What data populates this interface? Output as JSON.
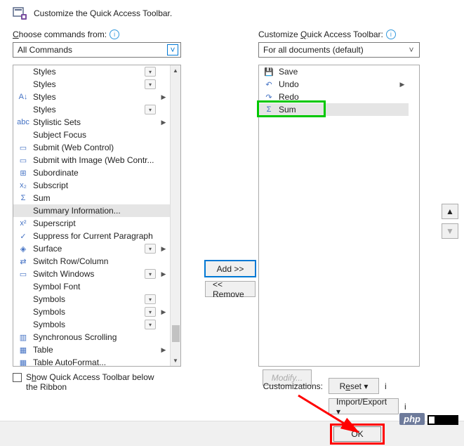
{
  "header": {
    "title": "Customize the Quick Access Toolbar."
  },
  "left": {
    "label": "Choose commands from:",
    "dropdown": "All Commands",
    "items": [
      {
        "label": "Styles",
        "icon": "",
        "drop": true,
        "sub": false
      },
      {
        "label": "Styles",
        "icon": "",
        "drop": true,
        "sub": false
      },
      {
        "label": "Styles",
        "icon": "A↓",
        "drop": false,
        "sub": true
      },
      {
        "label": "Styles",
        "icon": "",
        "drop": true,
        "sub": false
      },
      {
        "label": "Stylistic Sets",
        "icon": "abc",
        "drop": false,
        "sub": true
      },
      {
        "label": "Subject Focus",
        "icon": "",
        "drop": false,
        "sub": false
      },
      {
        "label": "Submit (Web Control)",
        "icon": "▭",
        "drop": false,
        "sub": false
      },
      {
        "label": "Submit with Image (Web Contr...",
        "icon": "▭",
        "drop": false,
        "sub": false
      },
      {
        "label": "Subordinate",
        "icon": "⊞",
        "drop": false,
        "sub": false
      },
      {
        "label": "Subscript",
        "icon": "x₂",
        "drop": false,
        "sub": false
      },
      {
        "label": "Sum",
        "icon": "Σ",
        "drop": false,
        "sub": false
      },
      {
        "label": "Summary Information...",
        "icon": "",
        "drop": false,
        "sub": false,
        "selected": true
      },
      {
        "label": "Superscript",
        "icon": "x²",
        "drop": false,
        "sub": false
      },
      {
        "label": "Suppress for Current Paragraph",
        "icon": "✓",
        "drop": false,
        "sub": false
      },
      {
        "label": "Surface",
        "icon": "◈",
        "drop": true,
        "sub": true
      },
      {
        "label": "Switch Row/Column",
        "icon": "⇄",
        "drop": false,
        "sub": false
      },
      {
        "label": "Switch Windows",
        "icon": "▭",
        "drop": true,
        "sub": true
      },
      {
        "label": "Symbol Font",
        "icon": "",
        "drop": false,
        "sub": false
      },
      {
        "label": "Symbols",
        "icon": "",
        "drop": true,
        "sub": false
      },
      {
        "label": "Symbols",
        "icon": "",
        "drop": true,
        "sub": true
      },
      {
        "label": "Symbols",
        "icon": "",
        "drop": true,
        "sub": false
      },
      {
        "label": "Synchronous Scrolling",
        "icon": "▥",
        "drop": false,
        "sub": false
      },
      {
        "label": "Table",
        "icon": "▦",
        "drop": false,
        "sub": true
      },
      {
        "label": "Table AutoFormat...",
        "icon": "▦",
        "drop": false,
        "sub": false
      }
    ]
  },
  "right": {
    "label": "Customize Quick Access Toolbar:",
    "dropdown": "For all documents (default)",
    "items": [
      {
        "label": "Save",
        "icon": "💾",
        "sub": false
      },
      {
        "label": "Undo",
        "icon": "↶",
        "sub": true
      },
      {
        "label": "Redo",
        "icon": "↷",
        "sub": false
      },
      {
        "label": "Sum",
        "icon": "Σ",
        "sub": false,
        "highlighted": true,
        "selected": true
      }
    ]
  },
  "buttons": {
    "add": "Add >>",
    "remove": "<< Remove",
    "modify": "Modify...",
    "ok": "OK",
    "reset": "Reset ▾",
    "import_export": "Import/Export ▾"
  },
  "checkbox_label": "Show Quick Access Toolbar below the Ribbon",
  "customizations_label": "Customizations:",
  "watermark": "php"
}
